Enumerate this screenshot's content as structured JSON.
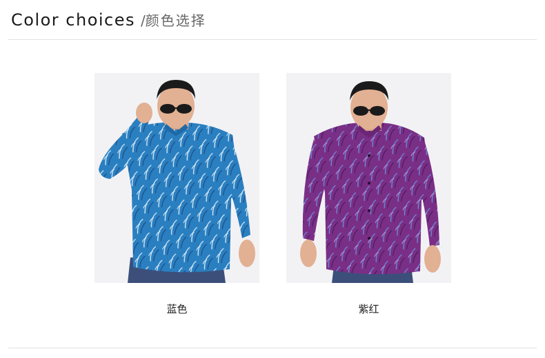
{
  "header": {
    "title_en": "Color choices",
    "separator": "/",
    "title_cn": "颜色选择"
  },
  "products": [
    {
      "label": "蓝色",
      "shirt_color": "#2a7fc0",
      "pattern_color": "#cfe6f5",
      "accent_color": "#1c4f8a"
    },
    {
      "label": "紫红",
      "shirt_color": "#7a2f86",
      "pattern_color": "#5c7fd0",
      "accent_color": "#4e1b5e"
    }
  ],
  "colors": {
    "background": "#ffffff",
    "photo_background": "#f2f2f4",
    "divider": "#e2e2e2",
    "jeans": "#3b4f7a",
    "skin": "#e2b093",
    "hair": "#1a1a1a"
  }
}
